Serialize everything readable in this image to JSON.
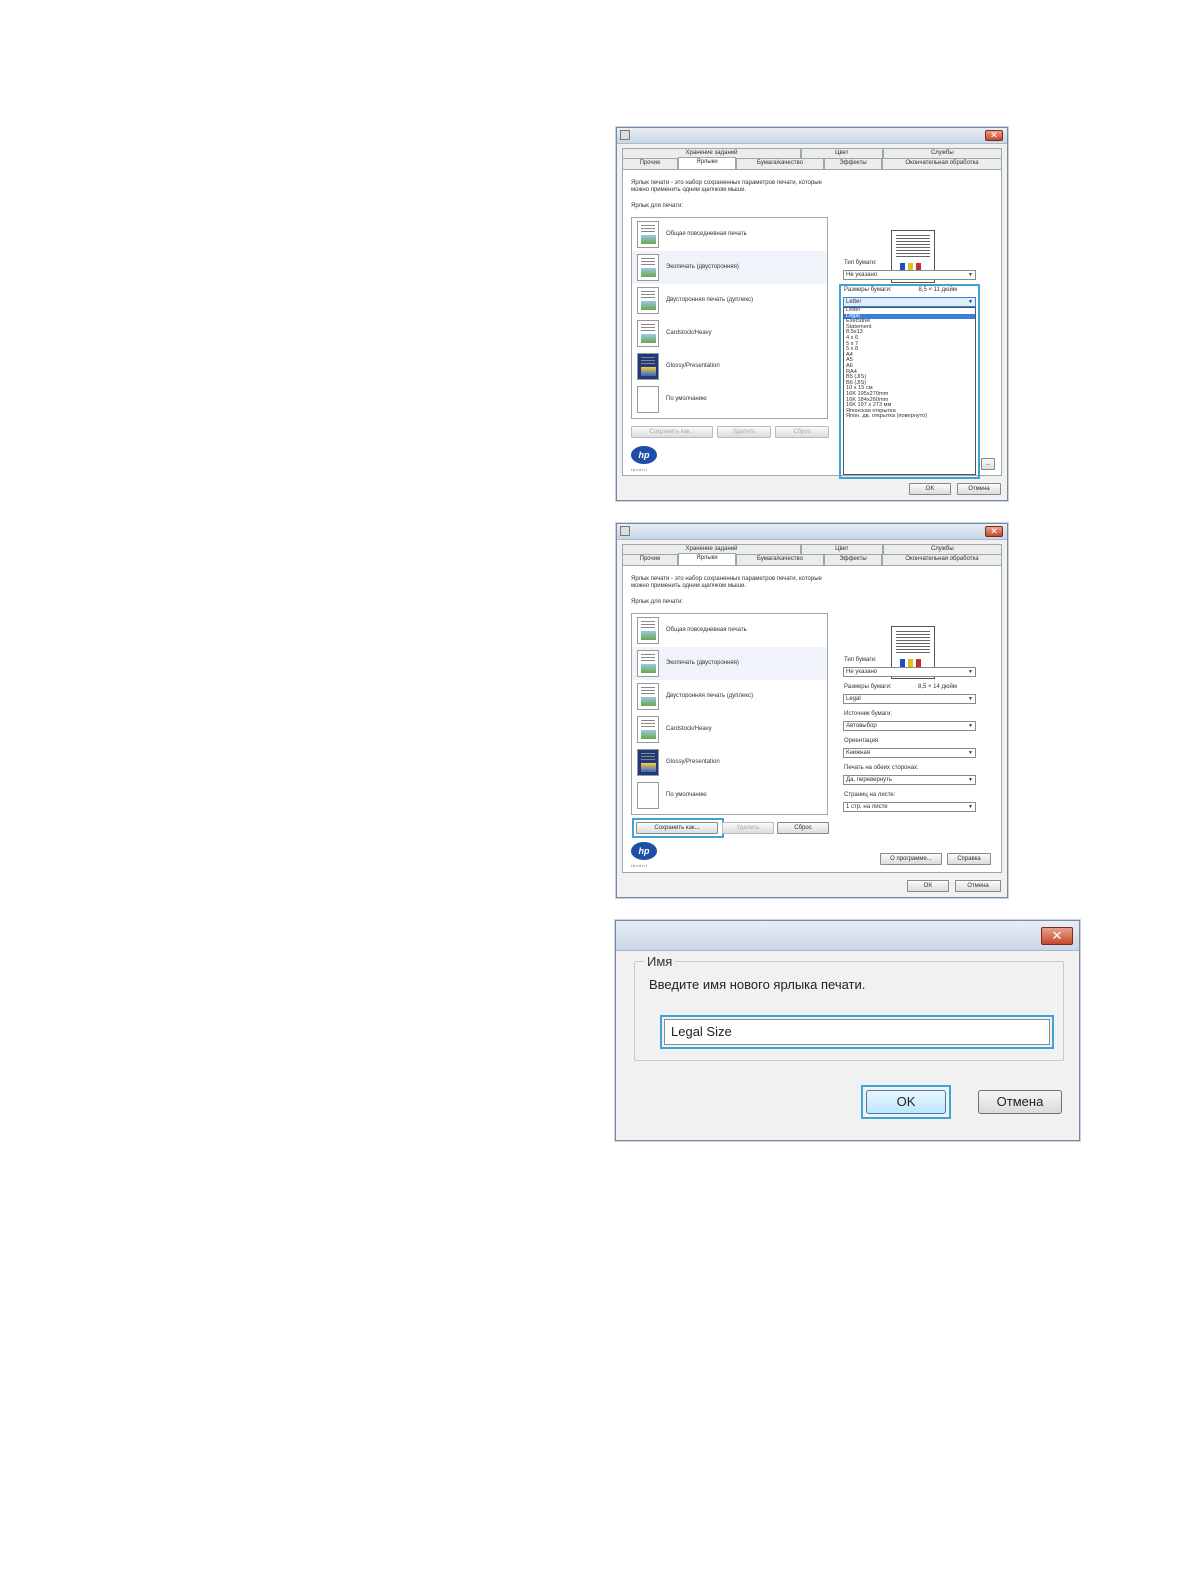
{
  "tabs_back": [
    "Хранение заданий",
    "Цвет",
    "Службы"
  ],
  "tabs_front": [
    "Прочие",
    "Ярлыки",
    "Бумага/качество",
    "Эффекты",
    "Окончательная обработка"
  ],
  "intro_line1": "Ярлык печати - это набор сохраненных параметров печати, которые",
  "intro_line2": "можно применить одним щелчком мыши.",
  "shortcuts_label": "Ярлык для печати:",
  "shortcuts": [
    "Общая повседневная печать",
    "Экопечать (двусторонняя)",
    "Двусторонняя печать (дуплекс)",
    "Cardstock/Heavy",
    "Glossy/Presentation",
    "По умолчанию"
  ],
  "buttons": {
    "save_as": "Сохранить как...",
    "delete": "Удалить",
    "reset": "Сброс",
    "ok": "OK",
    "cancel": "Отмена",
    "about": "О программе...",
    "help": "Справка"
  },
  "hp_logo_text": "hp",
  "hp_invent": "invent",
  "fields": {
    "paper_type_label": "Тип бумаги:",
    "paper_type_value": "Не указано",
    "paper_size_label": "Размеры бумаги:",
    "source_label": "Источник бумаги:",
    "source_value": "Автовыбор",
    "orientation_label": "Ориентация:",
    "orientation_value": "Книжная",
    "duplex_label": "Печать на обеих сторонах:",
    "duplex_value": "Да, перевернуть",
    "pages_label": "Страниц на листе:",
    "pages_value": "1 стр. на листе"
  },
  "dialog1": {
    "paper_size_dims": "8,5 × 11 дюйм",
    "paper_size_value": "Letter",
    "size_options": [
      "Letter",
      "Legal",
      "Executive",
      "Statement",
      "8.5x13",
      "4 x 6",
      "5 x 7",
      "5 x 8",
      "A4",
      "A5",
      "A6",
      "RA4",
      "B5 (JIS)",
      "B6 (JIS)",
      "10 x 15 см",
      "16K 195x270mm",
      "16K 184x260mm",
      "16K 197 x 273 мм",
      "Японская открытка",
      "Япон. дв. открытка (повернуто)"
    ],
    "selected_option": "Legal"
  },
  "dialog2": {
    "paper_size_dims": "8,5 × 14 дюйм",
    "paper_size_value": "Legal"
  },
  "dialog3": {
    "group_title": "Имя",
    "prompt": "Введите имя нового ярлыка печати.",
    "name_value": "Legal Size",
    "ok": "OK",
    "cancel": "Отмена"
  },
  "colors": {
    "highlight": "#3fa3d8",
    "selection": "#3c7fd8",
    "titlebar": "#c8d6e6"
  },
  "icons": [
    "printer-icon",
    "close-icon",
    "document-preview-icon",
    "hp-logo-icon",
    "dropdown-arrow-icon"
  ]
}
